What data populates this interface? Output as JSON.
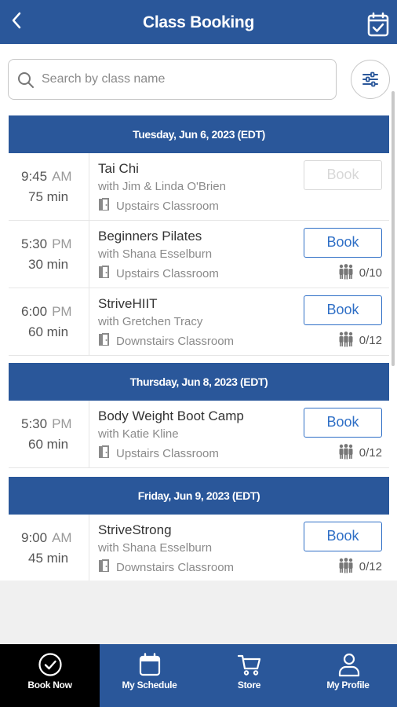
{
  "header": {
    "title": "Class Booking"
  },
  "search": {
    "placeholder": "Search by class name",
    "value": ""
  },
  "days": [
    {
      "label": "Tuesday, Jun 6, 2023 (EDT)",
      "classes": [
        {
          "time": "9:45",
          "ampm": "AM",
          "duration": "75 min",
          "name": "Tai Chi",
          "instructor": "with Jim & Linda O'Brien",
          "room": "Upstairs Classroom",
          "book_label": "Book",
          "book_enabled": false,
          "capacity": ""
        },
        {
          "time": "5:30",
          "ampm": "PM",
          "duration": "30 min",
          "name": "Beginners Pilates",
          "instructor": "with Shana Esselburn",
          "room": "Upstairs Classroom",
          "book_label": "Book",
          "book_enabled": true,
          "capacity": "0/10"
        },
        {
          "time": "6:00",
          "ampm": "PM",
          "duration": "60 min",
          "name": "StriveHIIT",
          "instructor": "with Gretchen Tracy",
          "room": "Downstairs Classroom",
          "book_label": "Book",
          "book_enabled": true,
          "capacity": "0/12"
        }
      ]
    },
    {
      "label": "Thursday, Jun 8, 2023 (EDT)",
      "classes": [
        {
          "time": "5:30",
          "ampm": "PM",
          "duration": "60 min",
          "name": "Body Weight Boot Camp",
          "instructor": "with Katie Kline",
          "room": "Upstairs Classroom",
          "book_label": "Book",
          "book_enabled": true,
          "capacity": "0/12"
        }
      ]
    },
    {
      "label": "Friday, Jun 9, 2023 (EDT)",
      "classes": [
        {
          "time": "9:00",
          "ampm": "AM",
          "duration": "45 min",
          "name": "StriveStrong",
          "instructor": "with Shana Esselburn",
          "room": "Downstairs Classroom",
          "book_label": "Book",
          "book_enabled": true,
          "capacity": "0/12"
        }
      ]
    }
  ],
  "nav": [
    {
      "label": "Book Now",
      "icon": "check-circle-icon",
      "active": true
    },
    {
      "label": "My Schedule",
      "icon": "calendar-icon",
      "active": false
    },
    {
      "label": "Store",
      "icon": "cart-icon",
      "active": false
    },
    {
      "label": "My Profile",
      "icon": "person-icon",
      "active": false
    }
  ],
  "colors": {
    "header_bg": "#2a579a",
    "accent": "#2f6fc6",
    "active_tab_bg": "#000000",
    "disabled": "#d8d8d8"
  }
}
